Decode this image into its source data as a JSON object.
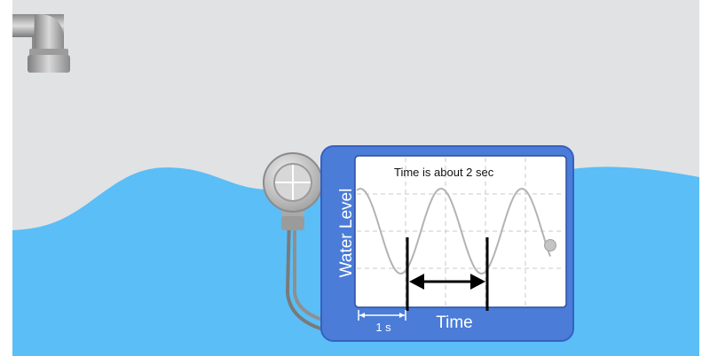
{
  "simulation": {
    "chart_title": "Time is about 2 sec",
    "y_axis_label": "Water Level",
    "x_axis_label": "Time",
    "scale_label": "1 s"
  },
  "colors": {
    "water": "#5bbef6",
    "background": "#e1e2e4",
    "detector_body": "#4a7cd8",
    "detector_border": "#3561c2",
    "plot_background": "#ffffff",
    "wave_trace": "#b3b3b3",
    "marker_lines": "#000000"
  },
  "icons": {
    "faucet": "faucet-icon",
    "probe": "crosshair-probe-icon"
  }
}
